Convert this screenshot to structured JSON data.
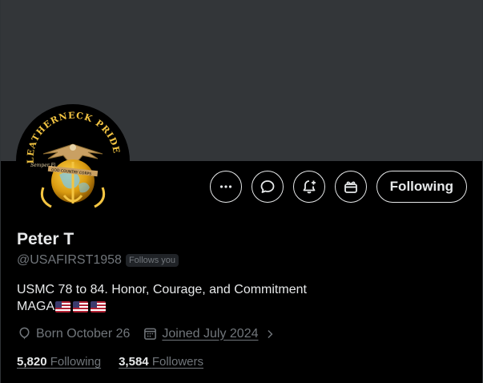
{
  "profile": {
    "name": "Peter T",
    "handle": "@USAFIRST1958",
    "follows_you": "Follows you",
    "bio_line1": "USMC 78 to 84. Honor, Courage, and Commitment",
    "bio_line2": "MAGA",
    "born": "Born October 26",
    "joined": "Joined July 2024",
    "following_count": "5,820",
    "following_label": "Following",
    "followers_count": "3,584",
    "followers_label": "Followers"
  },
  "avatar": {
    "top_text": "LEATHERNECK PRIDE",
    "left_text": "Semper Fi",
    "ribbon_text": "GOD COUNTRY CORPS"
  },
  "actions": {
    "follow_button": "Following"
  },
  "colors": {
    "banner": "#333639",
    "text_primary": "#e7e9ea",
    "text_secondary": "#71767b",
    "badge_bg": "#202327"
  }
}
